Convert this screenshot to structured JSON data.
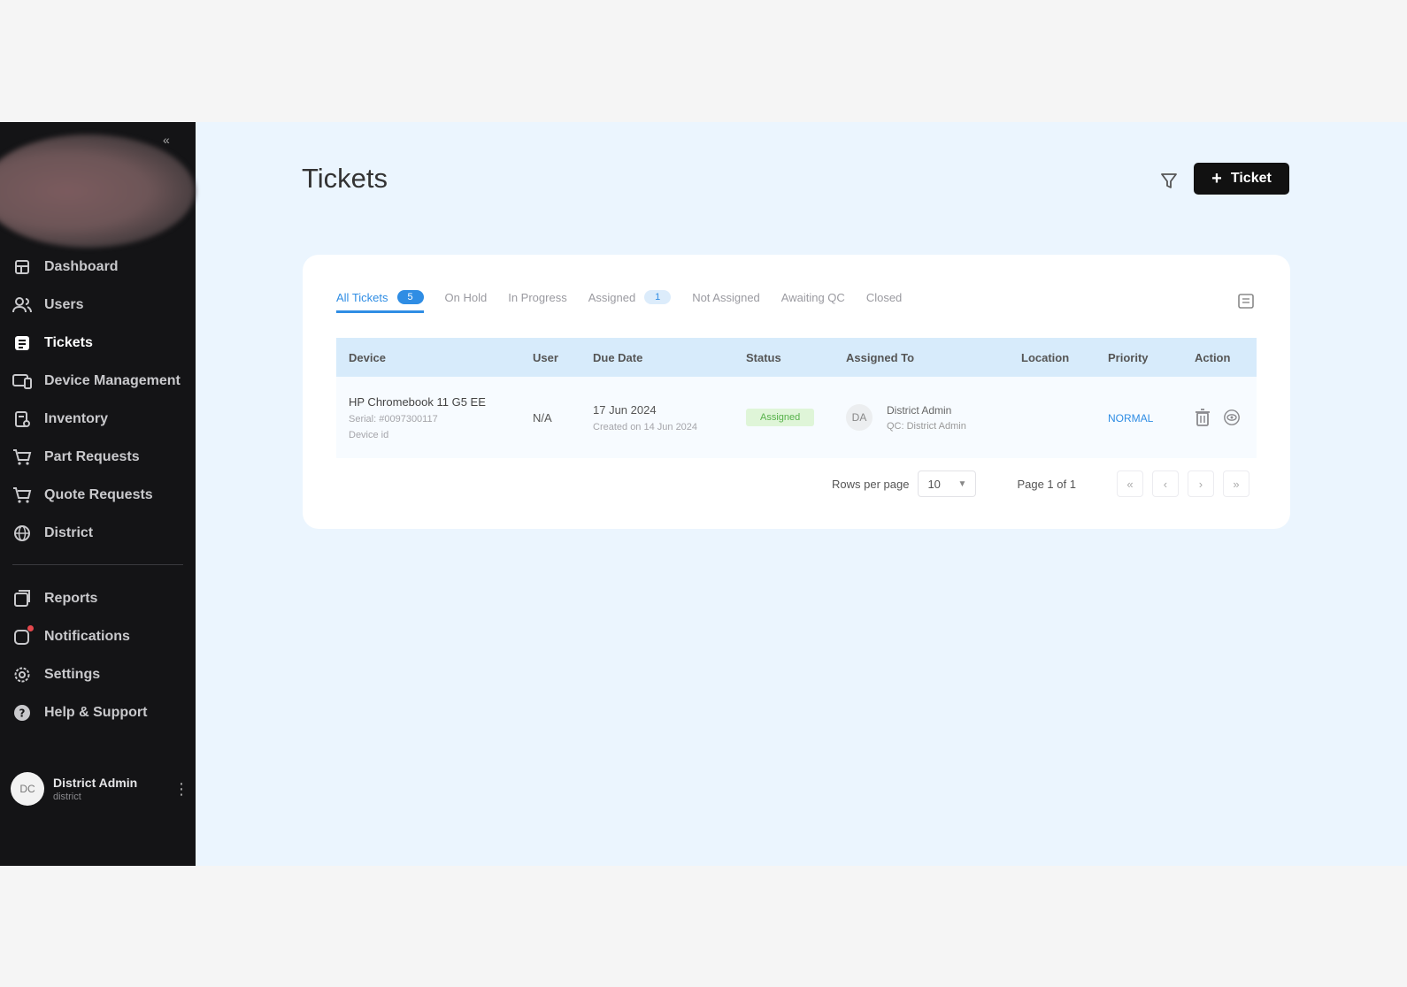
{
  "sidebar": {
    "collapse_label": "«",
    "items": [
      {
        "label": "Dashboard",
        "icon": "dashboard-icon"
      },
      {
        "label": "Users",
        "icon": "users-icon"
      },
      {
        "label": "Tickets",
        "icon": "tickets-icon"
      },
      {
        "label": "Device Management",
        "icon": "device-icon"
      },
      {
        "label": "Inventory",
        "icon": "inventory-icon"
      },
      {
        "label": "Part Requests",
        "icon": "cart-icon"
      },
      {
        "label": "Quote Requests",
        "icon": "cart-icon"
      },
      {
        "label": "District",
        "icon": "globe-icon"
      },
      {
        "label": "Reports",
        "icon": "reports-icon"
      },
      {
        "label": "Notifications",
        "icon": "bell-icon"
      },
      {
        "label": "Settings",
        "icon": "gear-icon"
      },
      {
        "label": "Help & Support",
        "icon": "help-icon"
      }
    ],
    "active_item": "Tickets",
    "profile": {
      "initials": "DC",
      "name": "District Admin",
      "role": "district"
    }
  },
  "header": {
    "title": "Tickets",
    "new_ticket_label": "Ticket"
  },
  "tabs": [
    {
      "label": "All Tickets",
      "badge": "5"
    },
    {
      "label": "On Hold",
      "badge": ""
    },
    {
      "label": "In Progress",
      "badge": ""
    },
    {
      "label": "Assigned",
      "badge": "1"
    },
    {
      "label": "Not Assigned",
      "badge": ""
    },
    {
      "label": "Awaiting QC",
      "badge": ""
    },
    {
      "label": "Closed",
      "badge": ""
    }
  ],
  "table": {
    "columns": [
      "Device",
      "User",
      "Due Date",
      "Status",
      "Assigned To",
      "Location",
      "Priority",
      "Action"
    ],
    "rows": [
      {
        "device": "HP Chromebook 11 G5 EE",
        "serial": "Serial: #0097300117",
        "device_id": "Device id",
        "user": "N/A",
        "due_date": "17 Jun 2024",
        "created": "Created on 14 Jun 2024",
        "status": "Assigned",
        "assignee_initials": "DA",
        "assignee": "District Admin",
        "qc": "QC: District Admin",
        "location": "",
        "priority": "NORMAL"
      }
    ]
  },
  "pagination": {
    "rows_per_page_label": "Rows per page",
    "rows_per_page": "10",
    "page_info": "Page 1 of 1",
    "first": "«",
    "prev": "‹",
    "next": "›",
    "last": "»"
  },
  "colors": {
    "sidebar_bg": "#141416",
    "main_bg": "#ebf5fe",
    "accent": "#2f8de4",
    "status_assigned_bg": "#dff5d8",
    "status_assigned_fg": "#56b14a"
  }
}
